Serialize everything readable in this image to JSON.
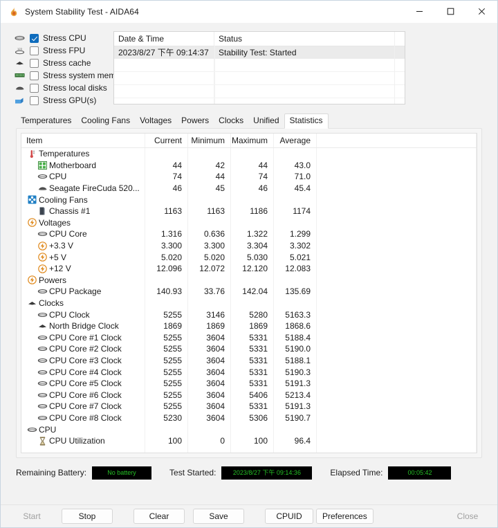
{
  "window": {
    "title": "System Stability Test - AIDA64",
    "icon": "flame-icon",
    "controls": {
      "minimize": "–",
      "maximize": "☐",
      "close": "✕"
    }
  },
  "stress_options": [
    {
      "label": "Stress CPU",
      "checked": true,
      "icon": "cpu-icon"
    },
    {
      "label": "Stress FPU",
      "checked": false,
      "icon": "fpu-icon"
    },
    {
      "label": "Stress cache",
      "checked": false,
      "icon": "cache-icon"
    },
    {
      "label": "Stress system memory",
      "checked": false,
      "icon": "memory-icon"
    },
    {
      "label": "Stress local disks",
      "checked": false,
      "icon": "disk-icon"
    },
    {
      "label": "Stress GPU(s)",
      "checked": false,
      "icon": "gpu-icon"
    }
  ],
  "log": {
    "columns": [
      "Date & Time",
      "Status"
    ],
    "rows": [
      {
        "datetime": "2023/8/27 下午 09:14:37",
        "status": "Stability Test: Started"
      }
    ]
  },
  "tabs": [
    {
      "label": "Temperatures",
      "active": false
    },
    {
      "label": "Cooling Fans",
      "active": false
    },
    {
      "label": "Voltages",
      "active": false
    },
    {
      "label": "Powers",
      "active": false
    },
    {
      "label": "Clocks",
      "active": false
    },
    {
      "label": "Unified",
      "active": false
    },
    {
      "label": "Statistics",
      "active": true
    }
  ],
  "statistics": {
    "columns": [
      "Item",
      "Current",
      "Minimum",
      "Maximum",
      "Average"
    ],
    "rows": [
      {
        "label": "Temperatures",
        "group": true,
        "icon": "thermometer-icon",
        "current": "",
        "minimum": "",
        "maximum": "",
        "average": ""
      },
      {
        "label": "Motherboard",
        "group": false,
        "icon": "motherboard-icon",
        "current": "44",
        "minimum": "42",
        "maximum": "44",
        "average": "43.0"
      },
      {
        "label": "CPU",
        "group": false,
        "icon": "cpu-icon",
        "current": "74",
        "minimum": "44",
        "maximum": "74",
        "average": "71.0"
      },
      {
        "label": "Seagate FireCuda 520...",
        "group": false,
        "icon": "disk-icon",
        "current": "46",
        "minimum": "45",
        "maximum": "46",
        "average": "45.4"
      },
      {
        "label": "Cooling Fans",
        "group": true,
        "icon": "fan-icon",
        "current": "",
        "minimum": "",
        "maximum": "",
        "average": ""
      },
      {
        "label": "Chassis #1",
        "group": false,
        "icon": "chassis-icon",
        "current": "1163",
        "minimum": "1163",
        "maximum": "1186",
        "average": "1174"
      },
      {
        "label": "Voltages",
        "group": true,
        "icon": "bolt-icon",
        "current": "",
        "minimum": "",
        "maximum": "",
        "average": ""
      },
      {
        "label": "CPU Core",
        "group": false,
        "icon": "cpu-icon",
        "current": "1.316",
        "minimum": "0.636",
        "maximum": "1.322",
        "average": "1.299"
      },
      {
        "label": "+3.3 V",
        "group": false,
        "icon": "bolt-icon",
        "current": "3.300",
        "minimum": "3.300",
        "maximum": "3.304",
        "average": "3.302"
      },
      {
        "label": "+5 V",
        "group": false,
        "icon": "bolt-icon",
        "current": "5.020",
        "minimum": "5.020",
        "maximum": "5.030",
        "average": "5.021"
      },
      {
        "label": "+12 V",
        "group": false,
        "icon": "bolt-icon",
        "current": "12.096",
        "minimum": "12.072",
        "maximum": "12.120",
        "average": "12.083"
      },
      {
        "label": "Powers",
        "group": true,
        "icon": "bolt-icon",
        "current": "",
        "minimum": "",
        "maximum": "",
        "average": ""
      },
      {
        "label": "CPU Package",
        "group": false,
        "icon": "cpu-icon",
        "current": "140.93",
        "minimum": "33.76",
        "maximum": "142.04",
        "average": "135.69"
      },
      {
        "label": "Clocks",
        "group": true,
        "icon": "cache-icon",
        "current": "",
        "minimum": "",
        "maximum": "",
        "average": ""
      },
      {
        "label": "CPU Clock",
        "group": false,
        "icon": "cpu-icon",
        "current": "5255",
        "minimum": "3146",
        "maximum": "5280",
        "average": "5163.3"
      },
      {
        "label": "North Bridge Clock",
        "group": false,
        "icon": "cache-icon",
        "current": "1869",
        "minimum": "1869",
        "maximum": "1869",
        "average": "1868.6"
      },
      {
        "label": "CPU Core #1 Clock",
        "group": false,
        "icon": "cpu-icon",
        "current": "5255",
        "minimum": "3604",
        "maximum": "5331",
        "average": "5188.4"
      },
      {
        "label": "CPU Core #2 Clock",
        "group": false,
        "icon": "cpu-icon",
        "current": "5255",
        "minimum": "3604",
        "maximum": "5331",
        "average": "5190.0"
      },
      {
        "label": "CPU Core #3 Clock",
        "group": false,
        "icon": "cpu-icon",
        "current": "5255",
        "minimum": "3604",
        "maximum": "5331",
        "average": "5188.1"
      },
      {
        "label": "CPU Core #4 Clock",
        "group": false,
        "icon": "cpu-icon",
        "current": "5255",
        "minimum": "3604",
        "maximum": "5331",
        "average": "5190.3"
      },
      {
        "label": "CPU Core #5 Clock",
        "group": false,
        "icon": "cpu-icon",
        "current": "5255",
        "minimum": "3604",
        "maximum": "5331",
        "average": "5191.3"
      },
      {
        "label": "CPU Core #6 Clock",
        "group": false,
        "icon": "cpu-icon",
        "current": "5255",
        "minimum": "3604",
        "maximum": "5406",
        "average": "5213.4"
      },
      {
        "label": "CPU Core #7 Clock",
        "group": false,
        "icon": "cpu-icon",
        "current": "5255",
        "minimum": "3604",
        "maximum": "5331",
        "average": "5191.3"
      },
      {
        "label": "CPU Core #8 Clock",
        "group": false,
        "icon": "cpu-icon",
        "current": "5230",
        "minimum": "3604",
        "maximum": "5306",
        "average": "5190.7"
      },
      {
        "label": "CPU",
        "group": true,
        "icon": "cpu-icon",
        "current": "",
        "minimum": "",
        "maximum": "",
        "average": ""
      },
      {
        "label": "CPU Utilization",
        "group": false,
        "icon": "hourglass-icon",
        "current": "100",
        "minimum": "0",
        "maximum": "100",
        "average": "96.4"
      }
    ]
  },
  "status": {
    "battery_label": "Remaining Battery:",
    "battery_value": "No battery",
    "started_label": "Test Started:",
    "started_value": "2023/8/27 下午 09:14:36",
    "elapsed_label": "Elapsed Time:",
    "elapsed_value": "00:05:42",
    "value_color": "#25c025",
    "value_bg": "#000000"
  },
  "buttons": {
    "start": "Start",
    "stop": "Stop",
    "clear": "Clear",
    "save": "Save",
    "cpuid": "CPUID",
    "preferences": "Preferences",
    "close": "Close"
  }
}
